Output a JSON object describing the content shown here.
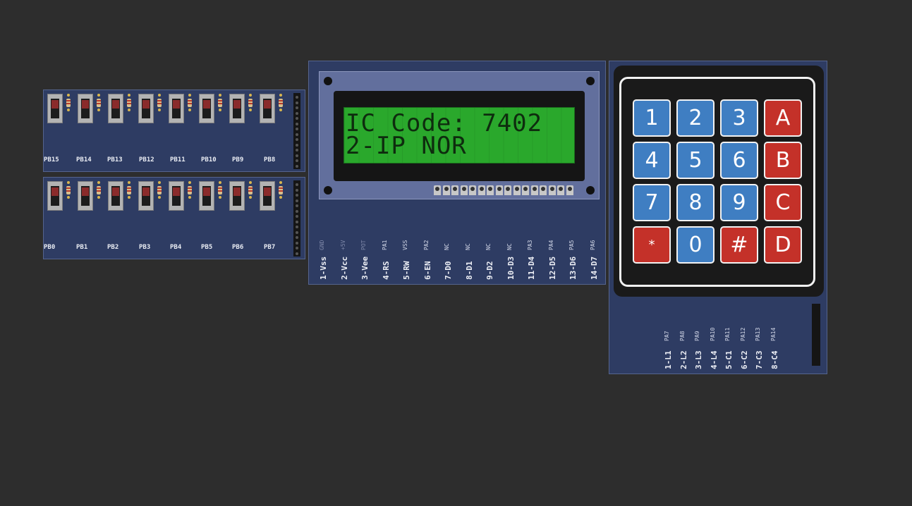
{
  "switch_boards": {
    "top": {
      "labels": [
        "PB15",
        "PB14",
        "PB13",
        "PB12",
        "PB11",
        "PB10",
        "PB9",
        "PB8"
      ]
    },
    "bottom": {
      "labels": [
        "PB0",
        "PB1",
        "PB2",
        "PB3",
        "PB4",
        "PB5",
        "PB6",
        "PB7"
      ]
    }
  },
  "lcd": {
    "line1": "IC Code: 7402",
    "line2": "2-IP NOR",
    "pins": [
      {
        "main": "1-Vss",
        "sub": "GND",
        "dim": true
      },
      {
        "main": "2-Vcc",
        "sub": "+5V",
        "dim": true
      },
      {
        "main": "3-Vee",
        "sub": "POT",
        "dim": true
      },
      {
        "main": "4-RS",
        "sub": "PA1",
        "dim": false
      },
      {
        "main": "5-RW",
        "sub": "VSS",
        "dim": false
      },
      {
        "main": "6-EN",
        "sub": "PA2",
        "dim": false
      },
      {
        "main": "7-D0",
        "sub": "NC",
        "dim": false
      },
      {
        "main": "8-D1",
        "sub": "NC",
        "dim": false
      },
      {
        "main": "9-D2",
        "sub": "NC",
        "dim": false
      },
      {
        "main": "10-D3",
        "sub": "NC",
        "dim": false
      },
      {
        "main": "11-D4",
        "sub": "PA3",
        "dim": false
      },
      {
        "main": "12-D5",
        "sub": "PA4",
        "dim": false
      },
      {
        "main": "13-D6",
        "sub": "PA5",
        "dim": false
      },
      {
        "main": "14-D7",
        "sub": "PA6",
        "dim": false
      }
    ]
  },
  "keypad": {
    "rows": [
      [
        {
          "label": "1",
          "color": "blue"
        },
        {
          "label": "2",
          "color": "blue"
        },
        {
          "label": "3",
          "color": "blue"
        },
        {
          "label": "A",
          "color": "red"
        }
      ],
      [
        {
          "label": "4",
          "color": "blue"
        },
        {
          "label": "5",
          "color": "blue"
        },
        {
          "label": "6",
          "color": "blue"
        },
        {
          "label": "B",
          "color": "red"
        }
      ],
      [
        {
          "label": "7",
          "color": "blue"
        },
        {
          "label": "8",
          "color": "blue"
        },
        {
          "label": "9",
          "color": "blue"
        },
        {
          "label": "C",
          "color": "red"
        }
      ],
      [
        {
          "label": "*",
          "color": "red"
        },
        {
          "label": "0",
          "color": "blue"
        },
        {
          "label": "#",
          "color": "red"
        },
        {
          "label": "D",
          "color": "red"
        }
      ]
    ],
    "pins": [
      {
        "main": "1-L1",
        "sub": "PA7"
      },
      {
        "main": "2-L2",
        "sub": "PA8"
      },
      {
        "main": "3-L3",
        "sub": "PA9"
      },
      {
        "main": "4-L4",
        "sub": "PA10"
      },
      {
        "main": "5-C1",
        "sub": "PA11"
      },
      {
        "main": "6-C2",
        "sub": "PA12"
      },
      {
        "main": "7-C3",
        "sub": "PA13"
      },
      {
        "main": "8-C4",
        "sub": "PA14"
      }
    ]
  },
  "colors": {
    "background": "#2d2d2d",
    "board": "#2e3c63",
    "lcd_screen": "#2aa82c",
    "key_blue": "#3f7ec2",
    "key_red": "#c43129"
  }
}
